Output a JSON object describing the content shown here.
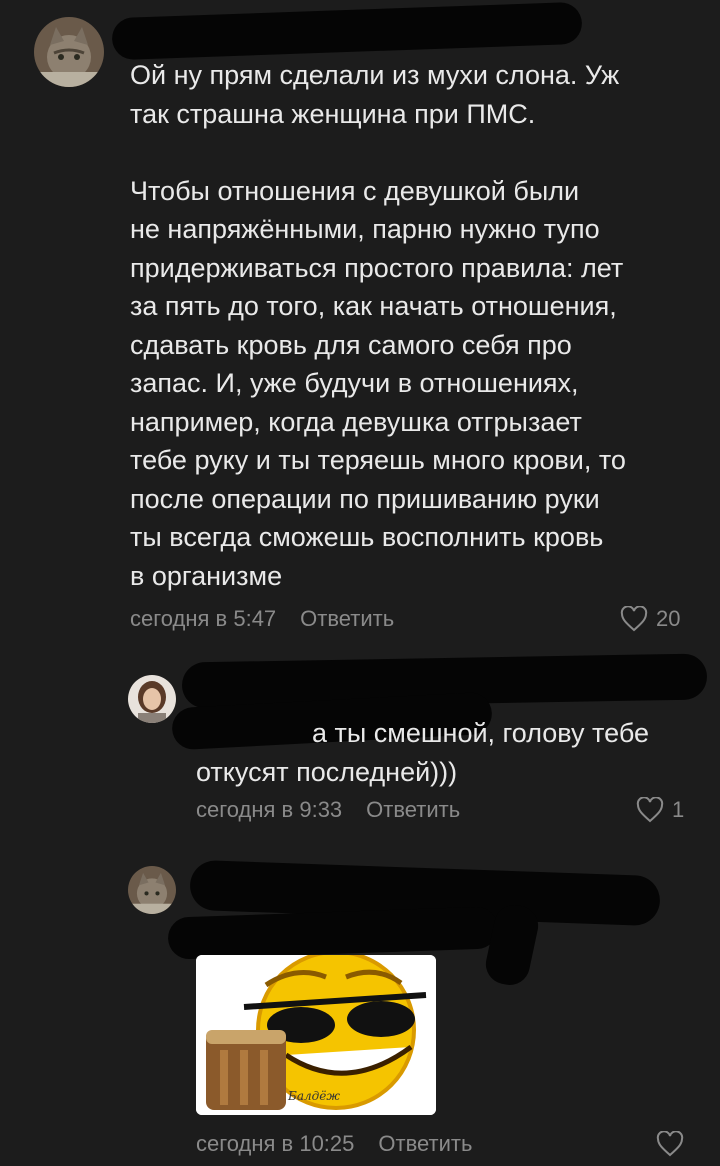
{
  "comments": [
    {
      "text": "Ой ну прям сделали из мухи слона. Уж\nтак страшна женщина при ПМС.\n\nЧтобы отношения с девушкой были\nне напряжёнными, парню нужно тупо\nпридерживаться простого правила: лет\nза пять до того, как начать отношения,\nсдавать кровь для самого себя про\nзапас. И, уже будучи в отношениях,\nнапример, когда девушка отгрызает\nтебе руку и ты теряешь много крови, то\nпосле операции по пришиванию руки\nты всегда сможешь восполнить кровь\nв организме",
      "time": "сегодня в 5:47",
      "reply": "Ответить",
      "likes": "20"
    },
    {
      "text": "а ты смешной, голову тебе\nоткусят последней)))",
      "time": "сегодня в 9:33",
      "reply": "Ответить",
      "likes": "1"
    },
    {
      "sticker_caption": "Балдёж",
      "time": "сегодня в 10:25",
      "reply": "Ответить",
      "likes": ""
    }
  ],
  "icons": {
    "like": "heart-outline-icon",
    "avatar_cat": "cat-avatar",
    "avatar_woman": "woman-avatar"
  },
  "colors": {
    "background": "#1c1c1c",
    "text": "#e9e9e9",
    "meta": "#8a8a8a",
    "emoji_yellow": "#f5c400"
  }
}
